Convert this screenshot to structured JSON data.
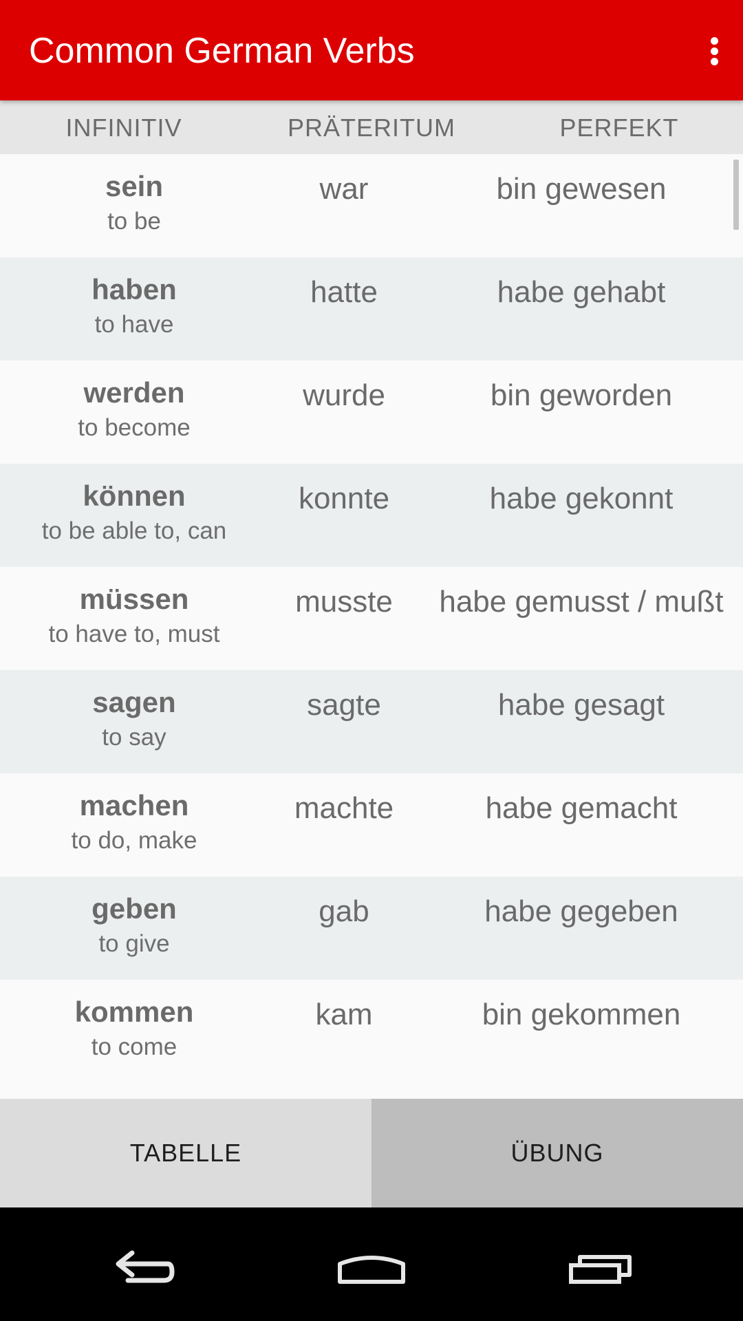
{
  "app_bar": {
    "title": "Common German Verbs",
    "background": "#dd0000",
    "menu_icon": "more-vert-icon"
  },
  "columns": [
    "INFINITIV",
    "PRÄTERITUM",
    "PERFEKT"
  ],
  "verbs": [
    {
      "infinitiv": "sein",
      "meaning": "to be",
      "praeteritum": "war",
      "perfekt": "bin gewesen"
    },
    {
      "infinitiv": "haben",
      "meaning": "to have",
      "praeteritum": "hatte",
      "perfekt": "habe gehabt"
    },
    {
      "infinitiv": "werden",
      "meaning": "to become",
      "praeteritum": "wurde",
      "perfekt": "bin geworden"
    },
    {
      "infinitiv": "können",
      "meaning": "to be able to, can",
      "praeteritum": "konnte",
      "perfekt": "habe gekonnt"
    },
    {
      "infinitiv": "müssen",
      "meaning": "to have to, must",
      "praeteritum": "musste",
      "perfekt": "habe gemusst / mußt"
    },
    {
      "infinitiv": "sagen",
      "meaning": "to say",
      "praeteritum": "sagte",
      "perfekt": "habe gesagt"
    },
    {
      "infinitiv": "machen",
      "meaning": "to do, make",
      "praeteritum": "machte",
      "perfekt": "habe gemacht"
    },
    {
      "infinitiv": "geben",
      "meaning": "to give",
      "praeteritum": "gab",
      "perfekt": "habe gegeben"
    },
    {
      "infinitiv": "kommen",
      "meaning": "to come",
      "praeteritum": "kam",
      "perfekt": "bin gekommen"
    }
  ],
  "tabs": [
    {
      "label": "TABELLE",
      "selected": true
    },
    {
      "label": "ÜBUNG",
      "selected": false
    }
  ],
  "nav_bar": {
    "back_icon": "back-icon",
    "home_icon": "home-icon",
    "recents_icon": "recents-icon"
  }
}
